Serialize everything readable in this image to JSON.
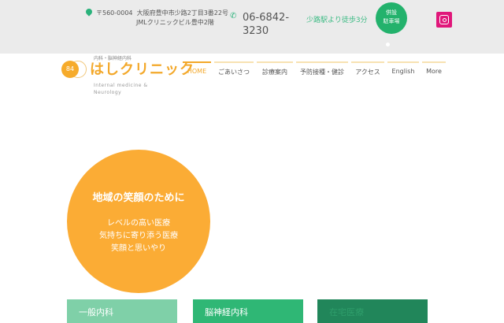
{
  "topbar": {
    "postal": "〒560-0004",
    "address1": "大阪府豊中市少路2丁目3番22号",
    "address2": "JMLクリニックビル豊中2階",
    "phone": "06-6842-3230",
    "walk": "少路駅より徒歩3分",
    "parking_line1": "併設",
    "parking_line2": "駐車場"
  },
  "logo": {
    "badge": "84",
    "subtitle": "内科・脳神経内科",
    "name": "はしクリニック",
    "english": "Internal medicine & Neurology"
  },
  "nav": [
    "HOME",
    "ごあいさつ",
    "診療案内",
    "予防接種・健診",
    "アクセス",
    "English",
    "More"
  ],
  "hero": {
    "title": "地域の笑顔のために",
    "lines": [
      "レベルの高い医療",
      "気持ちに寄り添う医療",
      "笑顔と思いやり"
    ]
  },
  "cards": [
    {
      "label": "一般内科",
      "color": "#7fd0a8"
    },
    {
      "label": "脳神経内科",
      "color": "#2fb775"
    },
    {
      "label": "在宅医療",
      "color": "#21865a"
    }
  ]
}
